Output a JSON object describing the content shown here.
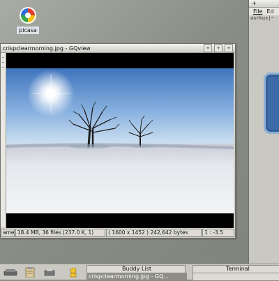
{
  "desktop": {
    "icon_label": "picasa"
  },
  "gqview": {
    "title": "crispclearmorning.jpg - GQview",
    "status": {
      "name": "ame",
      "folder_info": "18.4 MB, 36 files (237.0 K, 1)",
      "image_info": "( 1600 x 1452 ) 242,642 bytes",
      "zoom": "1 : -3.5"
    }
  },
  "right_window": {
    "menu": [
      "File",
      "Ed"
    ],
    "prompt": "asrkus|~"
  },
  "taskbar": {
    "tasks": {
      "buddy_list": "Buddy List",
      "gqview": "crispclearmorning.jpg - GQ...",
      "terminal": "Terminal"
    }
  },
  "colors": {
    "desktop_bg": "#8d9088",
    "sky_top": "#4a7ec4",
    "sky_bottom": "#c8dbee",
    "snow": "#e9ecf1"
  }
}
